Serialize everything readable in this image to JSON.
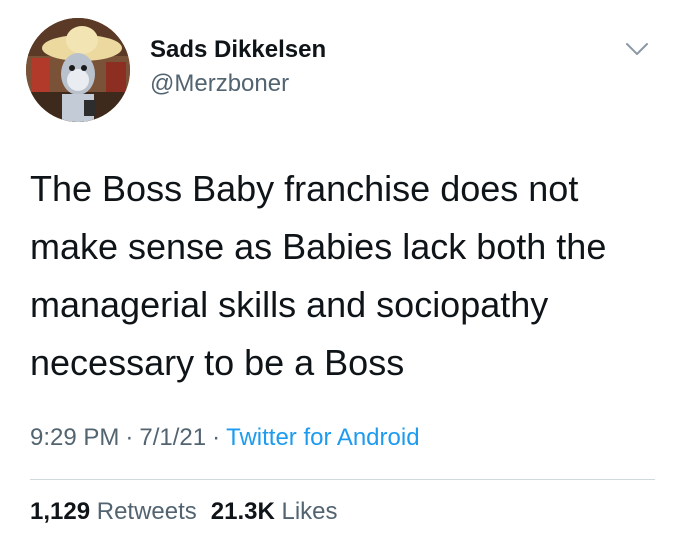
{
  "author": {
    "display_name": "Sads Dikkelsen",
    "handle": "@Merzboner",
    "avatar_icon": "cartoon-character-avatar"
  },
  "tweet": {
    "text": "The Boss Baby franchise does not\nmake sense as Babies lack both the\nmanagerial skills and sociopathy\nnecessary to be a Boss",
    "time": "9:29 PM",
    "date": "7/1/21",
    "separator": "·",
    "source": "Twitter for Android"
  },
  "stats": {
    "retweets_count": "1,129",
    "retweets_label": "Retweets",
    "likes_count": "21.3K",
    "likes_label": "Likes"
  },
  "colors": {
    "text": "#0f1419",
    "secondary": "#536471",
    "link": "#1d9bf0",
    "divider": "#cfd9de"
  }
}
